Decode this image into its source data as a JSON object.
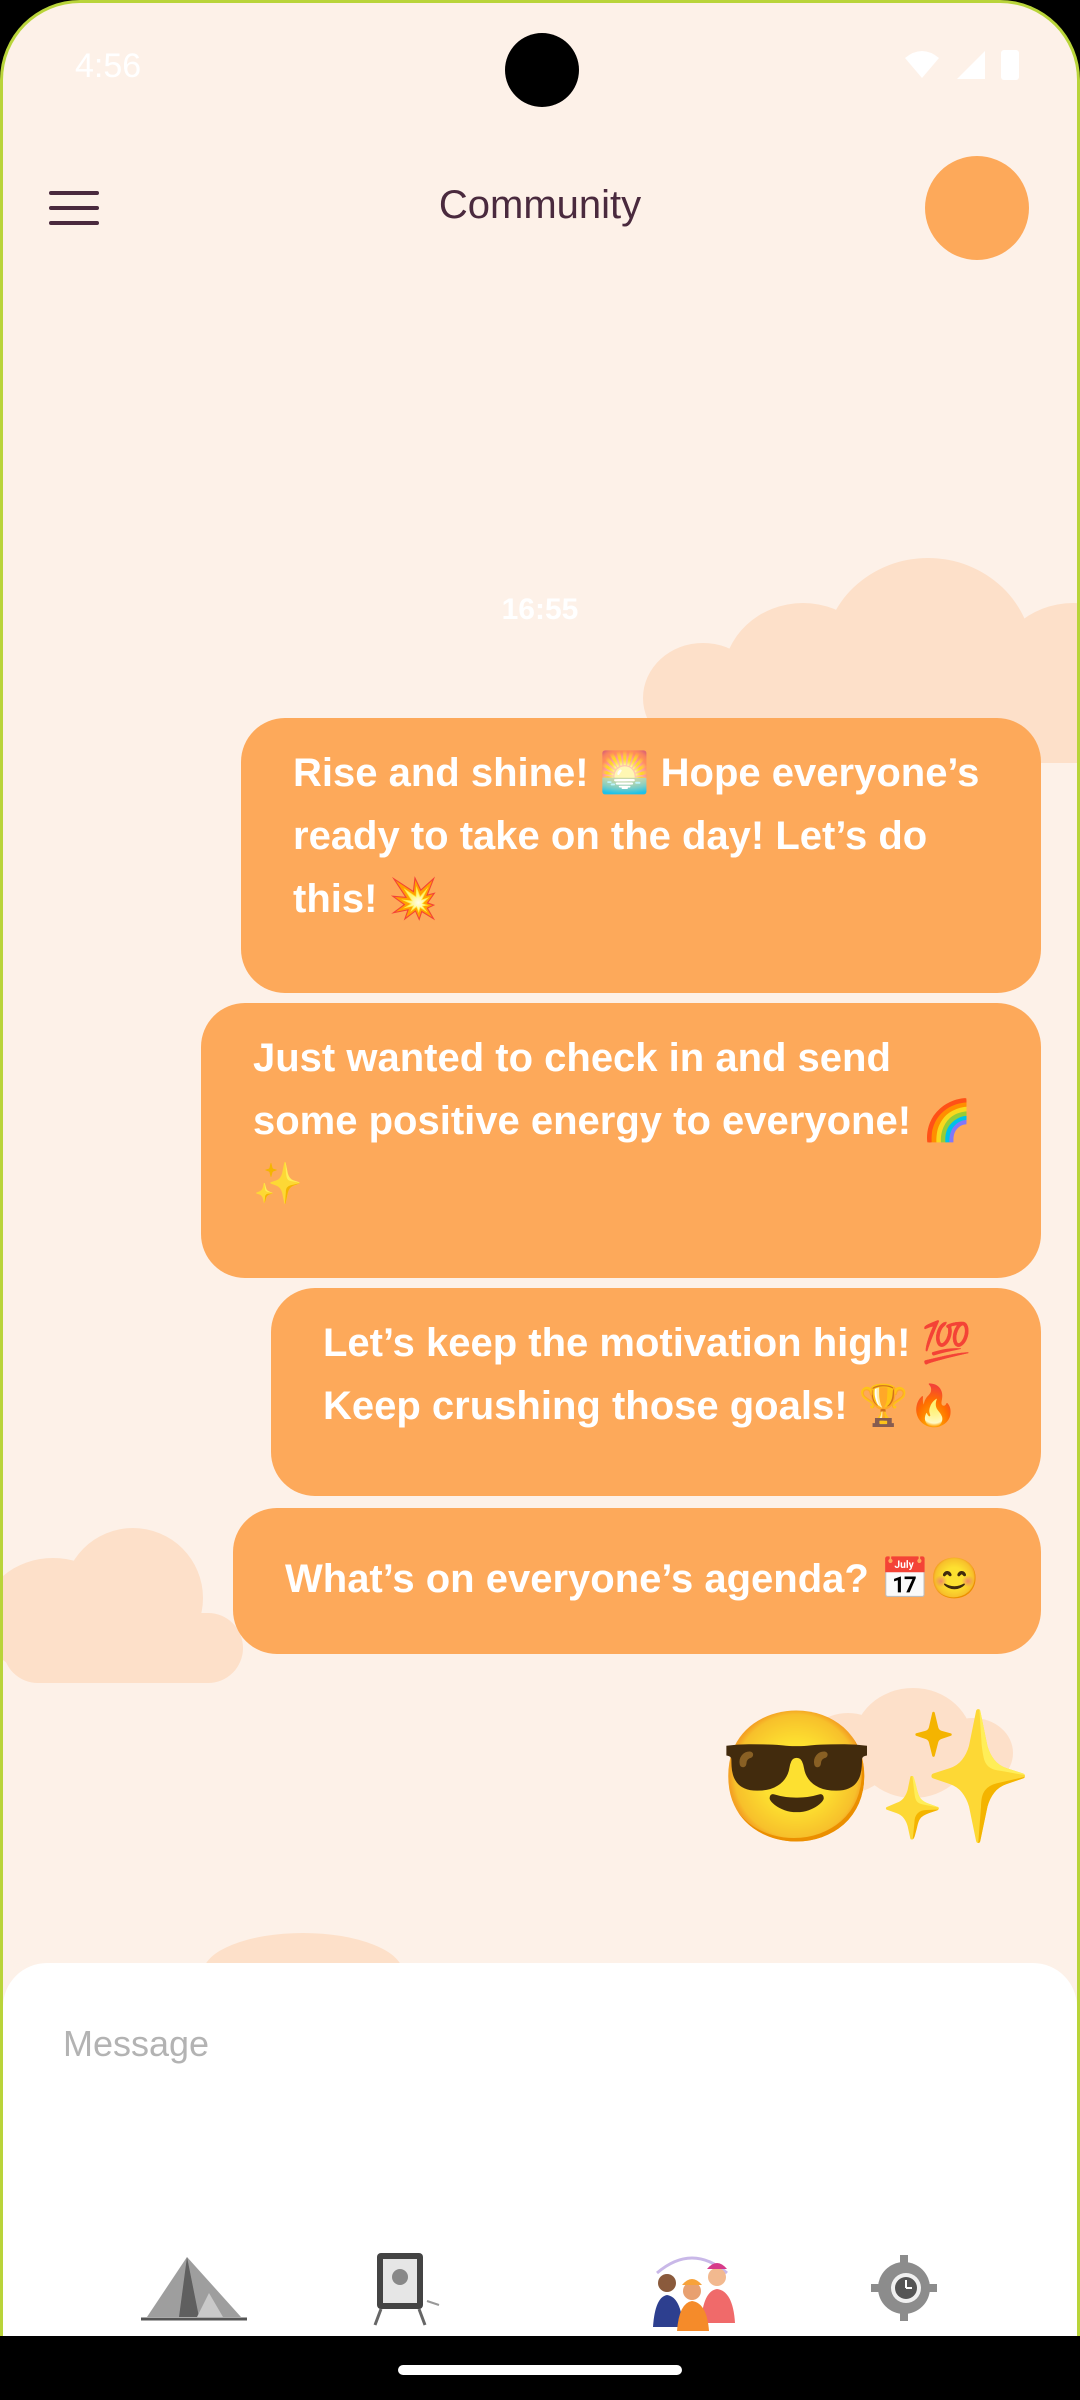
{
  "status_bar": {
    "time": "4:56"
  },
  "header": {
    "title": "Community"
  },
  "chat": {
    "timestamp": "16:55",
    "messages": [
      "Rise and shine! 🌅 Hope everyone’s ready to take on the day! Let’s do this! 💥",
      "Just wanted to check in and send some positive energy to everyone! 🌈 ✨",
      "Let’s keep the motivation high! 💯 Keep crushing those goals! 🏆🔥",
      "What’s on everyone’s agenda? 📅😊"
    ],
    "emoji_message": "😎✨"
  },
  "composer": {
    "placeholder": "Message"
  },
  "bottom_nav": {
    "items": [
      {
        "icon": "tent-icon"
      },
      {
        "icon": "whiteboard-icon"
      },
      {
        "icon": "community-icon"
      },
      {
        "icon": "settings-gear-icon"
      }
    ]
  },
  "colors": {
    "bubble": "#fda95a",
    "background": "#fdf1e8",
    "title": "#4a2a3e",
    "cloud": "#fde0c9"
  }
}
